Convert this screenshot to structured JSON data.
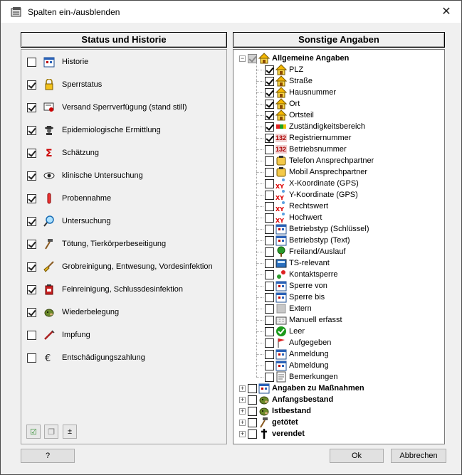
{
  "window": {
    "title": "Spalten ein-/ausblenden",
    "close_glyph": "✕"
  },
  "left": {
    "header": "Status und Historie",
    "items": [
      {
        "label": "Historie",
        "checked": false,
        "icon": "calendar-icon"
      },
      {
        "label": "Sperrstatus",
        "checked": true,
        "icon": "lock-icon"
      },
      {
        "label": "Versand Sperrverfügung (stand still)",
        "checked": true,
        "icon": "certificate-icon"
      },
      {
        "label": "Epidemiologische Ermittlung",
        "checked": true,
        "icon": "detective-icon"
      },
      {
        "label": "Schätzung",
        "checked": true,
        "icon": "sigma-icon"
      },
      {
        "label": "klinische Untersuchung",
        "checked": true,
        "icon": "eye-icon"
      },
      {
        "label": "Probennahme",
        "checked": true,
        "icon": "vial-icon"
      },
      {
        "label": "Untersuchung",
        "checked": true,
        "icon": "magnifier-icon"
      },
      {
        "label": "Tötung, Tierkörperbeseitigung",
        "checked": true,
        "icon": "hammer-icon"
      },
      {
        "label": "Grobreinigung, Entwesung, Vordesinfektion",
        "checked": true,
        "icon": "brush-icon"
      },
      {
        "label": "Feinreinigung, Schlussdesinfektion",
        "checked": true,
        "icon": "canister-icon"
      },
      {
        "label": "Wiederbelegung",
        "checked": true,
        "icon": "animal-head-icon"
      },
      {
        "label": "Impfung",
        "checked": false,
        "icon": "syringe-icon"
      },
      {
        "label": "Entschädigungszahlung",
        "checked": false,
        "icon": "euro-icon"
      }
    ]
  },
  "right": {
    "header": "Sonstige Angaben",
    "group_main": "Allgemeine Angaben",
    "children": [
      {
        "label": "PLZ",
        "checked": true,
        "icon": "house-icon"
      },
      {
        "label": "Straße",
        "checked": true,
        "icon": "house-icon"
      },
      {
        "label": "Hausnummer",
        "checked": true,
        "icon": "house-icon"
      },
      {
        "label": "Ort",
        "checked": true,
        "icon": "house-icon"
      },
      {
        "label": "Ortsteil",
        "checked": true,
        "icon": "house-icon"
      },
      {
        "label": "Zuständigkeitsbereich",
        "checked": true,
        "icon": "color-bar-icon"
      },
      {
        "label": "Registriernummer",
        "checked": true,
        "icon": "number-132-icon",
        "icon_text": "132"
      },
      {
        "label": "Betriebsnummer",
        "checked": false,
        "icon": "number-132-icon",
        "icon_text": "132"
      },
      {
        "label": "Telefon Ansprechpartner",
        "checked": false,
        "icon": "phone-icon"
      },
      {
        "label": "Mobil Ansprechpartner",
        "checked": false,
        "icon": "phone-icon"
      },
      {
        "label": "X-Koordinate (GPS)",
        "checked": false,
        "icon": "xy-icon"
      },
      {
        "label": "Y-Koordinate (GPS)",
        "checked": false,
        "icon": "xy-icon"
      },
      {
        "label": "Rechtswert",
        "checked": false,
        "icon": "xy-icon"
      },
      {
        "label": "Hochwert",
        "checked": false,
        "icon": "xy-icon"
      },
      {
        "label": "Betriebstyp (Schlüssel)",
        "checked": false,
        "icon": "calendar-icon"
      },
      {
        "label": "Betriebstyp (Text)",
        "checked": false,
        "icon": "calendar-icon"
      },
      {
        "label": "Freiland/Auslauf",
        "checked": false,
        "icon": "tree-icon"
      },
      {
        "label": "TS-relevant",
        "checked": false,
        "icon": "calculator-icon"
      },
      {
        "label": "Kontaktsperre",
        "checked": false,
        "icon": "contact-icon"
      },
      {
        "label": "Sperre von",
        "checked": false,
        "icon": "calendar-icon"
      },
      {
        "label": "Sperre bis",
        "checked": false,
        "icon": "calendar-icon"
      },
      {
        "label": "Extern",
        "checked": false,
        "icon": "grey-square-icon"
      },
      {
        "label": "Manuell erfasst",
        "checked": false,
        "icon": "keyboard-icon"
      },
      {
        "label": "Leer",
        "checked": false,
        "icon": "green-check-icon"
      },
      {
        "label": "Aufgegeben",
        "checked": false,
        "icon": "flag-icon"
      },
      {
        "label": "Anmeldung",
        "checked": false,
        "icon": "calendar-icon"
      },
      {
        "label": "Abmeldung",
        "checked": false,
        "icon": "calendar-icon"
      },
      {
        "label": "Bemerkungen",
        "checked": false,
        "icon": "note-icon"
      }
    ],
    "groups": [
      {
        "label": "Angaben zu Maßnahmen",
        "icon": "calendar-icon"
      },
      {
        "label": "Anfangsbestand",
        "icon": "animal-head-icon"
      },
      {
        "label": "Istbestand",
        "icon": "animal-head-icon"
      },
      {
        "label": "getötet",
        "icon": "hammer-icon"
      },
      {
        "label": "verendet",
        "icon": "cross-icon"
      }
    ]
  },
  "toolbar": {
    "select_all": "☑",
    "deselect_all": "❐",
    "invert": "±"
  },
  "buttons": {
    "help": "?",
    "ok": "Ok",
    "cancel": "Abbrechen"
  }
}
